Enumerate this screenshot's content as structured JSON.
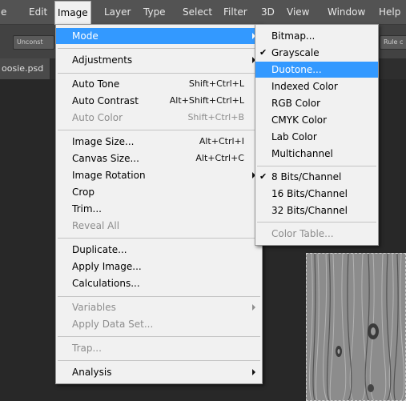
{
  "menubar": {
    "items": [
      "e",
      "Edit",
      "Image",
      "Layer",
      "Type",
      "Select",
      "Filter",
      "3D",
      "View",
      "Window",
      "Help"
    ]
  },
  "optionsbar": {
    "left_button": "Unconst",
    "right_button": "Rule c"
  },
  "document_tab": {
    "label": "oosie.psd"
  },
  "image_menu": {
    "mode": "Mode",
    "adjustments": "Adjustments",
    "auto_tone": "Auto Tone",
    "auto_tone_sc": "Shift+Ctrl+L",
    "auto_contrast": "Auto Contrast",
    "auto_contrast_sc": "Alt+Shift+Ctrl+L",
    "auto_color": "Auto Color",
    "auto_color_sc": "Shift+Ctrl+B",
    "image_size": "Image Size...",
    "image_size_sc": "Alt+Ctrl+I",
    "canvas_size": "Canvas Size...",
    "canvas_size_sc": "Alt+Ctrl+C",
    "image_rotation": "Image Rotation",
    "crop": "Crop",
    "trim": "Trim...",
    "reveal_all": "Reveal All",
    "duplicate": "Duplicate...",
    "apply_image": "Apply Image...",
    "calculations": "Calculations...",
    "variables": "Variables",
    "apply_data_set": "Apply Data Set...",
    "trap": "Trap...",
    "analysis": "Analysis"
  },
  "mode_menu": {
    "bitmap": "Bitmap...",
    "grayscale": "Grayscale",
    "duotone": "Duotone...",
    "indexed_color": "Indexed Color",
    "rgb_color": "RGB Color",
    "cmyk_color": "CMYK Color",
    "lab_color": "Lab Color",
    "multichannel": "Multichannel",
    "bits8": "8 Bits/Channel",
    "bits16": "16 Bits/Channel",
    "bits32": "32 Bits/Channel",
    "color_table": "Color Table...",
    "checkmark": "✔"
  },
  "colors": {
    "highlight": "#3399ff",
    "menu_bg": "#f1f1f1",
    "app_bg": "#282828"
  }
}
